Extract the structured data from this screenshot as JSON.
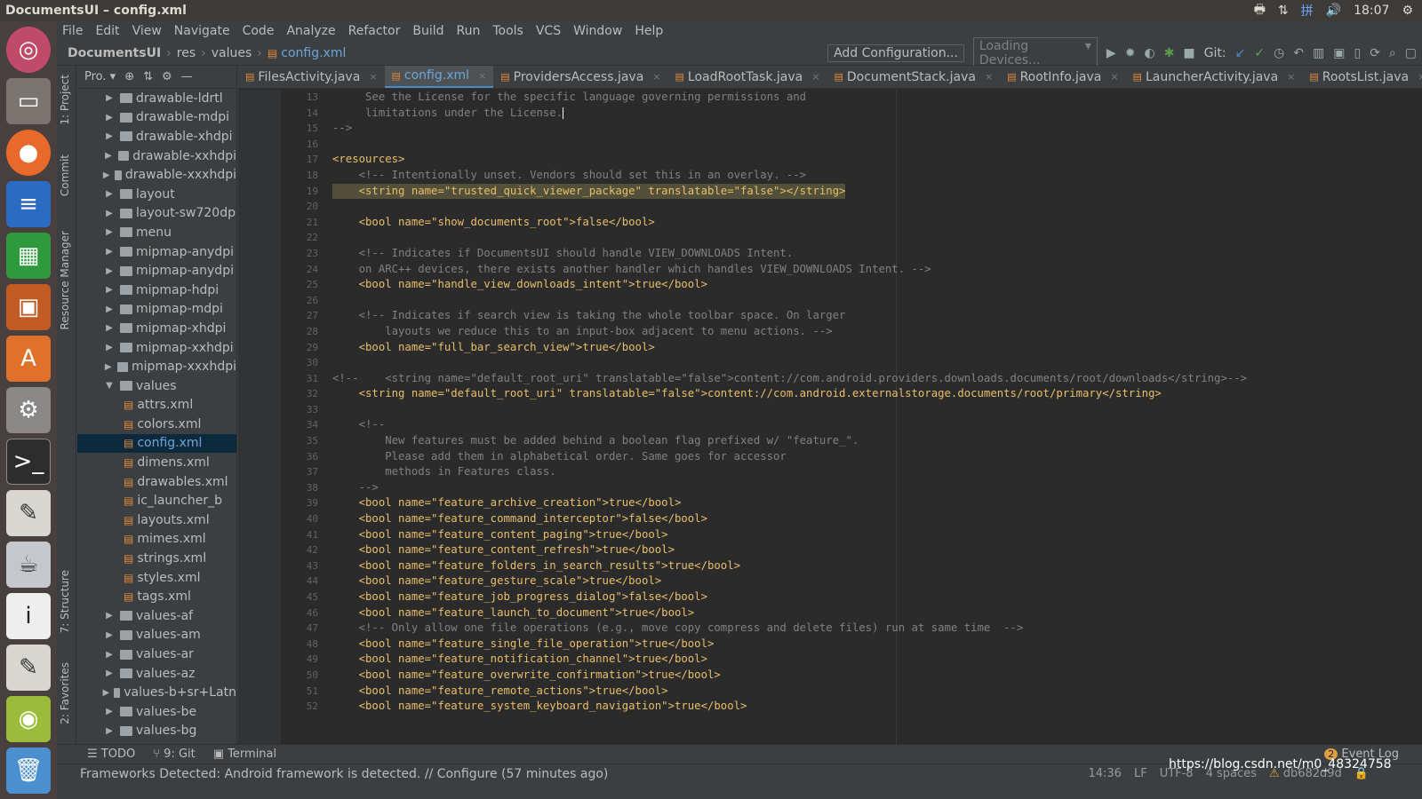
{
  "window": {
    "title": "DocumentsUI – config.xml"
  },
  "system_tray": {
    "clock": "18:07"
  },
  "launcher": {
    "apps": [
      "ubuntu-icon",
      "files-icon",
      "firefox-icon",
      "writer-icon",
      "calc-icon",
      "impress-icon",
      "software-center-icon",
      "settings-icon",
      "terminal-icon",
      "text-editor-icon",
      "java-icon",
      "info-icon",
      "notes-icon",
      "image-viewer-icon",
      "trash-icon"
    ]
  },
  "menu": [
    "File",
    "Edit",
    "View",
    "Navigate",
    "Code",
    "Analyze",
    "Refactor",
    "Build",
    "Run",
    "Tools",
    "VCS",
    "Window",
    "Help"
  ],
  "breadcrumb": [
    "DocumentsUI",
    "res",
    "values",
    "config.xml"
  ],
  "toolbar": {
    "add_configuration": "Add Configuration...",
    "loading_devices": "Loading Devices...",
    "git_label": "Git:"
  },
  "left_strip": {
    "project": "1: Project",
    "commit": "Commit",
    "resource_manager": "Resource Manager",
    "structure": "7: Structure",
    "favorites": "2: Favorites"
  },
  "project_panel": {
    "header": "Pro.",
    "items": [
      {
        "label": "drawable-ldrtl",
        "type": "folder",
        "arrow": "▶"
      },
      {
        "label": "drawable-mdpi",
        "type": "folder",
        "arrow": "▶"
      },
      {
        "label": "drawable-xhdpi",
        "type": "folder",
        "arrow": "▶"
      },
      {
        "label": "drawable-xxhdpi",
        "type": "folder",
        "arrow": "▶"
      },
      {
        "label": "drawable-xxxhdpi",
        "type": "folder",
        "arrow": "▶"
      },
      {
        "label": "layout",
        "type": "folder",
        "arrow": "▶"
      },
      {
        "label": "layout-sw720dp",
        "type": "folder",
        "arrow": "▶"
      },
      {
        "label": "menu",
        "type": "folder",
        "arrow": "▶"
      },
      {
        "label": "mipmap-anydpi",
        "type": "folder",
        "arrow": "▶"
      },
      {
        "label": "mipmap-anydpi",
        "type": "folder",
        "arrow": "▶"
      },
      {
        "label": "mipmap-hdpi",
        "type": "folder",
        "arrow": "▶"
      },
      {
        "label": "mipmap-mdpi",
        "type": "folder",
        "arrow": "▶"
      },
      {
        "label": "mipmap-xhdpi",
        "type": "folder",
        "arrow": "▶"
      },
      {
        "label": "mipmap-xxhdpi",
        "type": "folder",
        "arrow": "▶"
      },
      {
        "label": "mipmap-xxxhdpi",
        "type": "folder",
        "arrow": "▶"
      },
      {
        "label": "values",
        "type": "folder",
        "arrow": "▼"
      },
      {
        "label": "attrs.xml",
        "type": "file",
        "arrow": ""
      },
      {
        "label": "colors.xml",
        "type": "file",
        "arrow": ""
      },
      {
        "label": "config.xml",
        "type": "file",
        "arrow": "",
        "selected": true
      },
      {
        "label": "dimens.xml",
        "type": "file",
        "arrow": ""
      },
      {
        "label": "drawables.xml",
        "type": "file",
        "arrow": ""
      },
      {
        "label": "ic_launcher_b",
        "type": "file",
        "arrow": ""
      },
      {
        "label": "layouts.xml",
        "type": "file",
        "arrow": ""
      },
      {
        "label": "mimes.xml",
        "type": "file",
        "arrow": ""
      },
      {
        "label": "strings.xml",
        "type": "file",
        "arrow": ""
      },
      {
        "label": "styles.xml",
        "type": "file",
        "arrow": ""
      },
      {
        "label": "tags.xml",
        "type": "file",
        "arrow": ""
      },
      {
        "label": "values-af",
        "type": "folder",
        "arrow": "▶"
      },
      {
        "label": "values-am",
        "type": "folder",
        "arrow": "▶"
      },
      {
        "label": "values-ar",
        "type": "folder",
        "arrow": "▶"
      },
      {
        "label": "values-az",
        "type": "folder",
        "arrow": "▶"
      },
      {
        "label": "values-b+sr+Latn",
        "type": "folder",
        "arrow": "▶"
      },
      {
        "label": "values-be",
        "type": "folder",
        "arrow": "▶"
      },
      {
        "label": "values-bg",
        "type": "folder",
        "arrow": "▶"
      }
    ]
  },
  "editor_tabs": [
    {
      "label": "FilesActivity.java",
      "active": false
    },
    {
      "label": "config.xml",
      "active": true
    },
    {
      "label": "ProvidersAccess.java",
      "active": false
    },
    {
      "label": "LoadRootTask.java",
      "active": false
    },
    {
      "label": "DocumentStack.java",
      "active": false
    },
    {
      "label": "RootInfo.java",
      "active": false
    },
    {
      "label": "LauncherActivity.java",
      "active": false
    },
    {
      "label": "RootsList.java",
      "active": false
    }
  ],
  "code_lines": [
    {
      "n": "13",
      "text": "     See the License for the specific language governing permissions and",
      "kind": "comment"
    },
    {
      "n": "14",
      "text": "     limitations under the License.",
      "kind": "comment",
      "caret": true
    },
    {
      "n": "15",
      "text": "-->",
      "kind": "comment"
    },
    {
      "n": "16",
      "text": "",
      "kind": "plain"
    },
    {
      "n": "17",
      "text": "<resources>",
      "kind": "tag"
    },
    {
      "n": "18",
      "text": "    <!-- Intentionally unset. Vendors should set this in an overlay. -->",
      "kind": "comment"
    },
    {
      "n": "19",
      "text": "    <string name=\"trusted_quick_viewer_package\" translatable=\"false\"></string>",
      "kind": "tag",
      "highlight": true
    },
    {
      "n": "20",
      "text": "",
      "kind": "plain"
    },
    {
      "n": "21",
      "text": "    <bool name=\"show_documents_root\">false</bool>",
      "kind": "tag"
    },
    {
      "n": "22",
      "text": "",
      "kind": "plain"
    },
    {
      "n": "23",
      "text": "    <!-- Indicates if DocumentsUI should handle VIEW_DOWNLOADS Intent.",
      "kind": "comment"
    },
    {
      "n": "24",
      "text": "    on ARC++ devices, there exists another handler which handles VIEW_DOWNLOADS Intent. -->",
      "kind": "comment"
    },
    {
      "n": "25",
      "text": "    <bool name=\"handle_view_downloads_intent\">true</bool>",
      "kind": "tag"
    },
    {
      "n": "26",
      "text": "",
      "kind": "plain"
    },
    {
      "n": "27",
      "text": "    <!-- Indicates if search view is taking the whole toolbar space. On larger",
      "kind": "comment"
    },
    {
      "n": "28",
      "text": "        layouts we reduce this to an input-box adjacent to menu actions. -->",
      "kind": "comment"
    },
    {
      "n": "29",
      "text": "    <bool name=\"full_bar_search_view\">true</bool>",
      "kind": "tag"
    },
    {
      "n": "30",
      "text": "",
      "kind": "plain"
    },
    {
      "n": "31",
      "text": "<!--    <string name=\"default_root_uri\" translatable=\"false\">content://com.android.providers.downloads.documents/root/downloads</string>-->",
      "kind": "comment"
    },
    {
      "n": "32",
      "text": "    <string name=\"default_root_uri\" translatable=\"false\">content://com.android.externalstorage.documents/root/primary</string>",
      "kind": "tag"
    },
    {
      "n": "33",
      "text": "",
      "kind": "plain"
    },
    {
      "n": "34",
      "text": "    <!--",
      "kind": "comment"
    },
    {
      "n": "35",
      "text": "        New features must be added behind a boolean flag prefixed w/ \"feature_\".",
      "kind": "comment"
    },
    {
      "n": "36",
      "text": "        Please add them in alphabetical order. Same goes for accessor",
      "kind": "comment"
    },
    {
      "n": "37",
      "text": "        methods in Features class.",
      "kind": "comment"
    },
    {
      "n": "38",
      "text": "    -->",
      "kind": "comment"
    },
    {
      "n": "39",
      "text": "    <bool name=\"feature_archive_creation\">true</bool>",
      "kind": "tag"
    },
    {
      "n": "40",
      "text": "    <bool name=\"feature_command_interceptor\">false</bool>",
      "kind": "tag"
    },
    {
      "n": "41",
      "text": "    <bool name=\"feature_content_paging\">true</bool>",
      "kind": "tag"
    },
    {
      "n": "42",
      "text": "    <bool name=\"feature_content_refresh\">true</bool>",
      "kind": "tag"
    },
    {
      "n": "43",
      "text": "    <bool name=\"feature_folders_in_search_results\">true</bool>",
      "kind": "tag"
    },
    {
      "n": "44",
      "text": "    <bool name=\"feature_gesture_scale\">true</bool>",
      "kind": "tag"
    },
    {
      "n": "45",
      "text": "    <bool name=\"feature_job_progress_dialog\">false</bool>",
      "kind": "tag"
    },
    {
      "n": "46",
      "text": "    <bool name=\"feature_launch_to_document\">true</bool>",
      "kind": "tag"
    },
    {
      "n": "47",
      "text": "    <!-- Only allow one file operations (e.g., move copy compress and delete files) run at same time  -->",
      "kind": "comment"
    },
    {
      "n": "48",
      "text": "    <bool name=\"feature_single_file_operation\">true</bool>",
      "kind": "tag"
    },
    {
      "n": "49",
      "text": "    <bool name=\"feature_notification_channel\">true</bool>",
      "kind": "tag"
    },
    {
      "n": "50",
      "text": "    <bool name=\"feature_overwrite_confirmation\">true</bool>",
      "kind": "tag"
    },
    {
      "n": "51",
      "text": "    <bool name=\"feature_remote_actions\">true</bool>",
      "kind": "tag"
    },
    {
      "n": "52",
      "text": "    <bool name=\"feature_system_keyboard_navigation\">true</bool>",
      "kind": "tag"
    }
  ],
  "bottom_tools": {
    "todo": "TODO",
    "git": "9: Git",
    "terminal": "Terminal",
    "event_log": "Event Log",
    "event_count": "2"
  },
  "status_bar": {
    "message": "Frameworks Detected: Android framework is detected. // Configure (57 minutes ago)",
    "position": "14:36",
    "line_sep": "LF",
    "encoding": "UTF-8",
    "indent": "4 spaces",
    "branch": "db682d9d"
  },
  "watermark": "https://blog.csdn.net/m0_48324758"
}
